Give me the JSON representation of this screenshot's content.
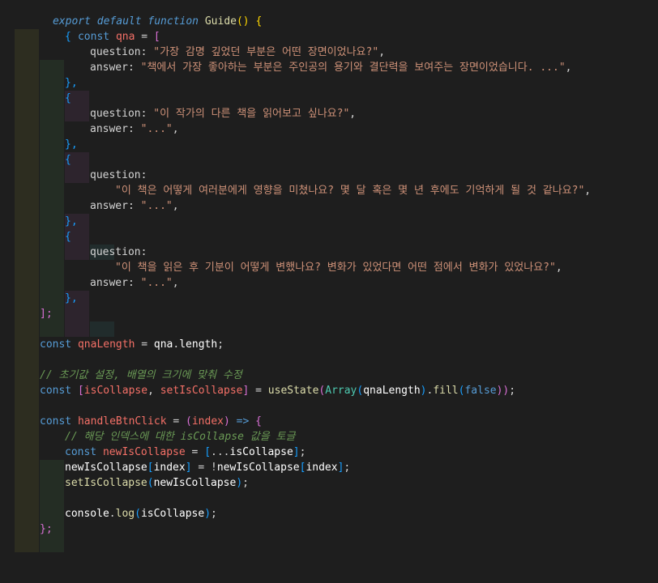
{
  "code": {
    "line1": {
      "export": "export",
      "default": "default",
      "function": "function",
      "name": "Guide",
      "open": "()",
      "brace": "{"
    },
    "line2": {
      "const": "const",
      "name": "qna",
      "eq": " = ",
      "bracket": "["
    },
    "q1": {
      "open": "{",
      "qkey": "question",
      "qval": "\"가장 감명 깊었던 부분은 어떤 장면이었나요?\"",
      "akey": "answer",
      "aval": "\"책에서 가장 좋아하는 부분은 주인공의 용기와 결단력을 보여주는 장면이었습니다. ...\"",
      "close": "},"
    },
    "q2": {
      "open": "{",
      "qkey": "question",
      "qval": "\"이 작가의 다른 책을 읽어보고 싶나요?\"",
      "akey": "answer",
      "aval": "\"...\"",
      "close": "},"
    },
    "q3": {
      "open": "{",
      "qkey": "question",
      "qval": "\"이 책은 어떻게 여러분에게 영향을 미쳤나요? 몇 달 혹은 몇 년 후에도 기억하게 될 것 같나요?\"",
      "akey": "answer",
      "aval": "\"...\"",
      "close": "},"
    },
    "q4": {
      "open": "{",
      "qkey": "question",
      "qval": "\"이 책을 읽은 후 기분이 어떻게 변했나요? 변화가 있었다면 어떤 점에서 변화가 있었나요?\"",
      "akey": "answer",
      "aval": "\"...\"",
      "close": "},"
    },
    "arrclose": "];",
    "lenLine": {
      "const": "const",
      "name": "qnaLength",
      "eq": " = ",
      "obj": "qna",
      "prop": "length",
      "semi": ";"
    },
    "comment1": "// 초기값 설정, 배열의 크기에 맞춰 수정",
    "stateLine": {
      "const": "const",
      "lb": "[",
      "a": "isCollapse",
      "comma": ", ",
      "b": "setIsCollapse",
      "rb": "]",
      "eq": " = ",
      "useState": "useState",
      "p1": "(",
      "Array": "Array",
      "p2": "(",
      "arg": "qnaLength",
      "p3": ")",
      "fill": "fill",
      "p4": "(",
      "false": "false",
      "p5": "))",
      "semi": ";"
    },
    "handler": {
      "const": "const",
      "name": "handleBtnClick",
      "eq": " = ",
      "p1": "(",
      "param": "index",
      "p2": ")",
      "arrow": " => ",
      "brace": "{"
    },
    "comment2": "// 해당 인덱스에 대한 isCollapse 값을 토글",
    "newLine": {
      "const": "const",
      "name": "newIsCollapse",
      "eq": " = ",
      "lb": "[",
      "spread": "...",
      "src": "isCollapse",
      "rb": "]",
      "semi": ";"
    },
    "assignLine": {
      "a": "newIsCollapse",
      "lb": "[",
      "idx": "index",
      "rb": "]",
      "eq": " = ",
      "not": "!",
      "b": "newIsCollapse",
      "lb2": "[",
      "idx2": "index",
      "rb2": "]",
      "semi": ";"
    },
    "setLine": {
      "fn": "setIsCollapse",
      "p1": "(",
      "arg": "newIsCollapse",
      "p2": ")",
      "semi": ";"
    },
    "logLine": {
      "obj": "console",
      "dot": ".",
      "fn": "log",
      "p1": "(",
      "arg": "isCollapse",
      "p2": ")",
      "semi": ";"
    },
    "handlerClose": "};"
  }
}
